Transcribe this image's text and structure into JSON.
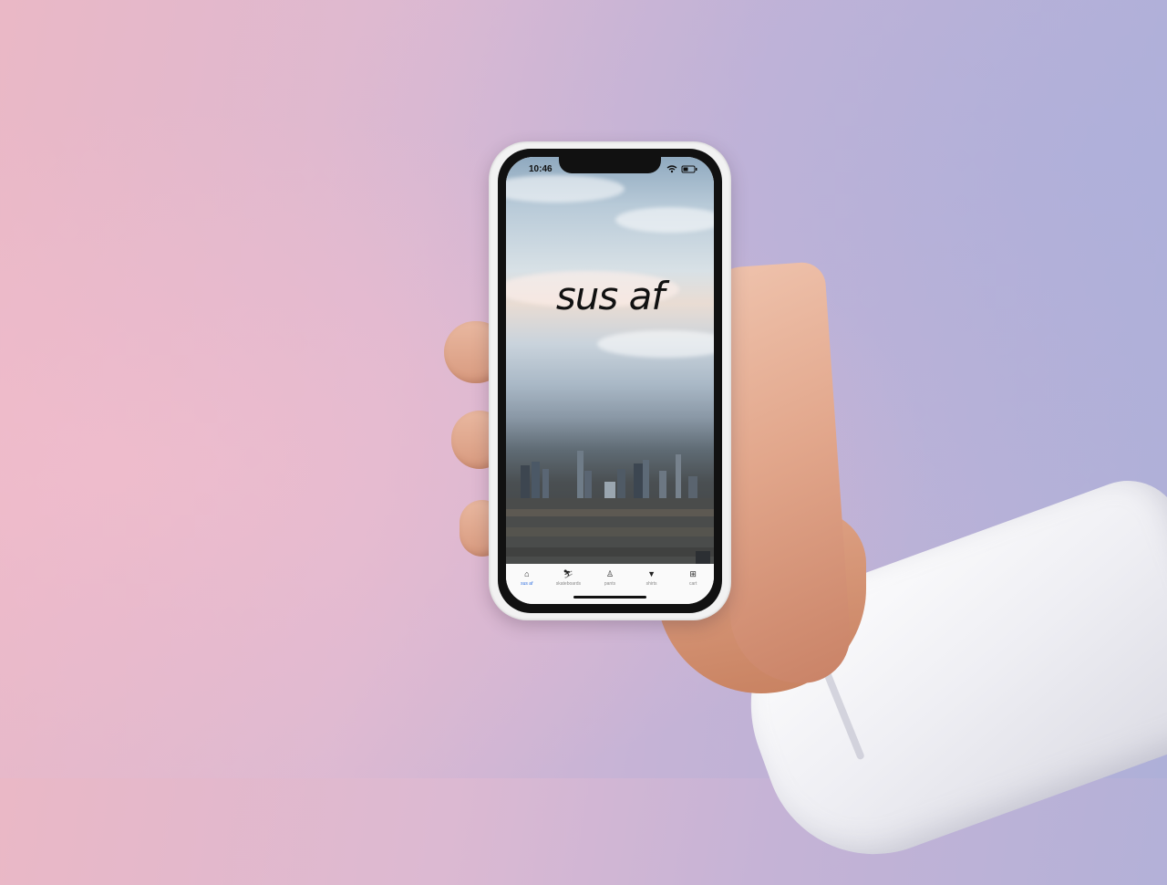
{
  "status_bar": {
    "time": "10:46"
  },
  "hero": {
    "title": "sus af"
  },
  "tabs": [
    {
      "label": "sus af",
      "icon": "home-icon",
      "active": true
    },
    {
      "label": "skateboards",
      "icon": "skateboarder-icon",
      "active": false
    },
    {
      "label": "pants",
      "icon": "person-icon",
      "active": false
    },
    {
      "label": "shirts",
      "icon": "shirt-icon",
      "active": false
    },
    {
      "label": "cart",
      "icon": "cart-icon",
      "active": false
    }
  ],
  "colors": {
    "accent": "#2f6fdf"
  }
}
